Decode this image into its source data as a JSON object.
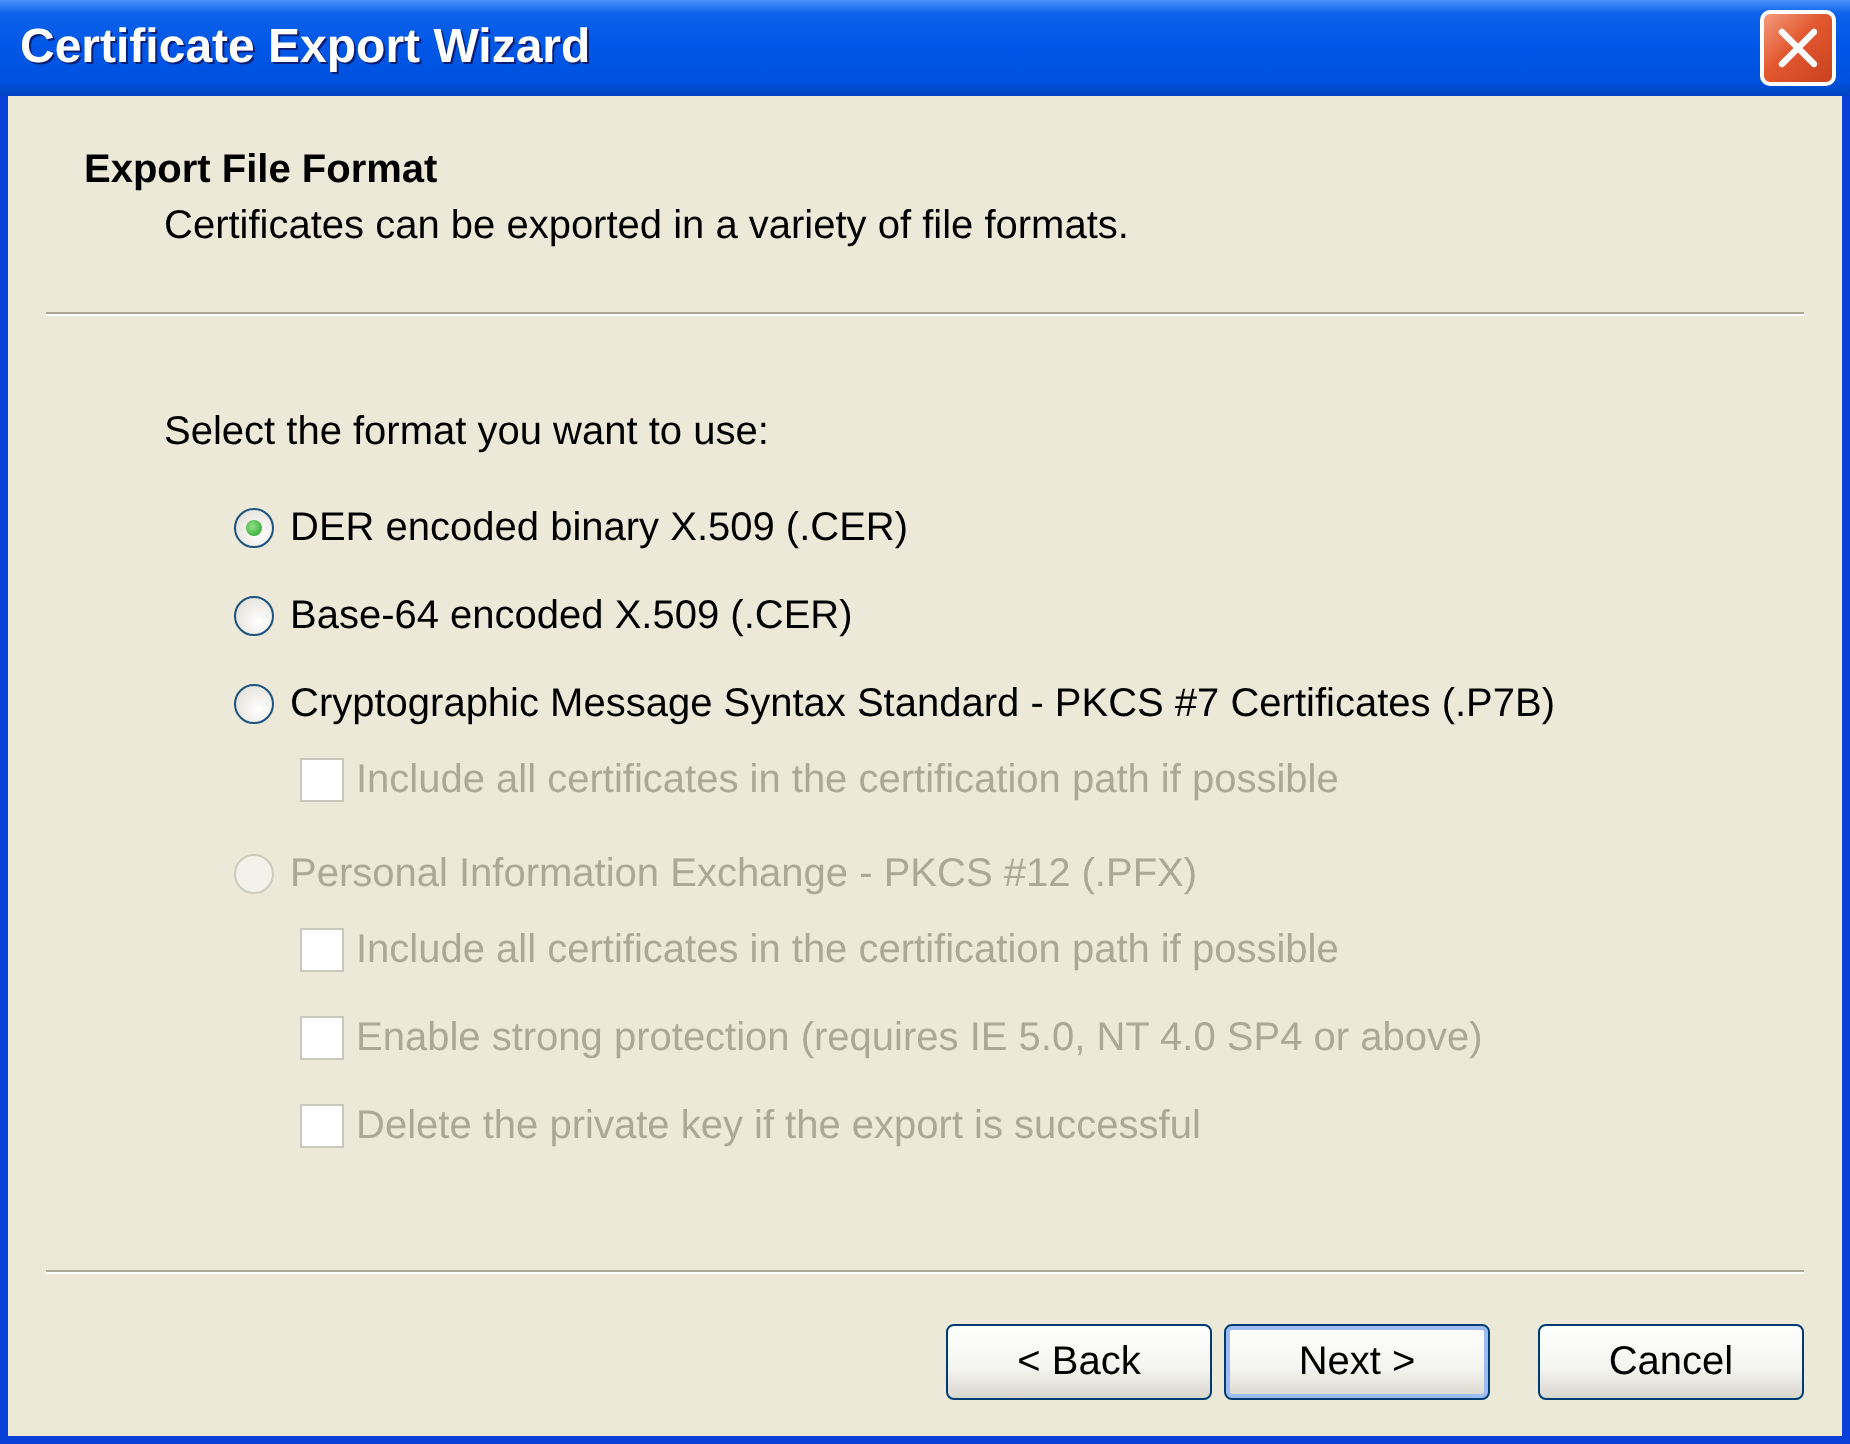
{
  "window": {
    "title": "Certificate Export Wizard"
  },
  "header": {
    "title": "Export File Format",
    "subtitle": "Certificates can be exported in a variety of file formats."
  },
  "prompt": "Select the format you want to use:",
  "options": [
    {
      "kind": "radio",
      "label": "DER encoded binary X.509 (.CER)",
      "selected": true,
      "disabled": false
    },
    {
      "kind": "radio",
      "label": "Base-64 encoded X.509 (.CER)",
      "selected": false,
      "disabled": false
    },
    {
      "kind": "radio",
      "label": "Cryptographic Message Syntax Standard - PKCS #7 Certificates (.P7B)",
      "selected": false,
      "disabled": false,
      "children": [
        {
          "kind": "checkbox",
          "label": "Include all certificates in the certification path if possible",
          "checked": false,
          "disabled": true
        }
      ]
    },
    {
      "kind": "radio",
      "label": "Personal Information Exchange - PKCS #12 (.PFX)",
      "selected": false,
      "disabled": true,
      "children": [
        {
          "kind": "checkbox",
          "label": "Include all certificates in the certification path if possible",
          "checked": false,
          "disabled": true
        },
        {
          "kind": "checkbox",
          "label": "Enable strong protection (requires IE 5.0, NT 4.0 SP4 or above)",
          "checked": false,
          "disabled": true
        },
        {
          "kind": "checkbox",
          "label": "Delete the private key if the export is successful",
          "checked": false,
          "disabled": true
        }
      ]
    }
  ],
  "buttons": [
    {
      "label": "< Back",
      "default": false
    },
    {
      "label": "Next >",
      "default": true
    },
    {
      "label": "Cancel",
      "default": false
    }
  ]
}
